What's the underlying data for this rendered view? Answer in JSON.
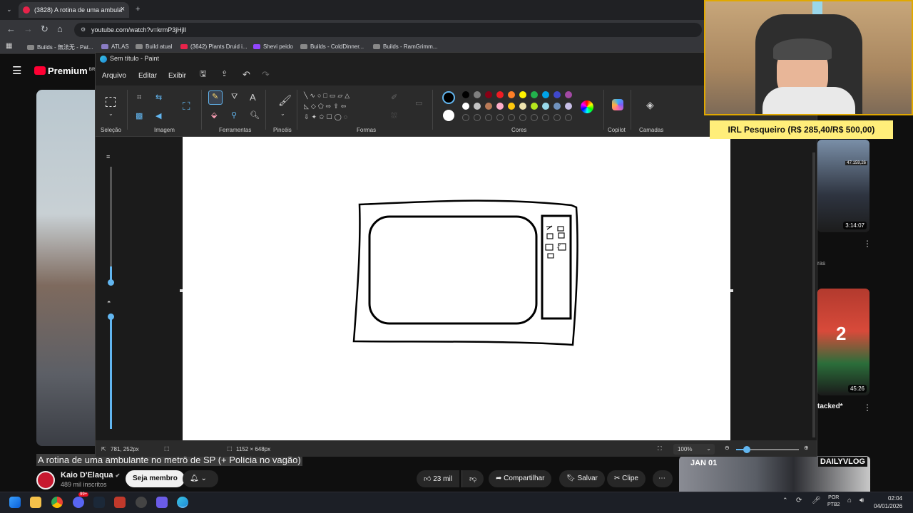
{
  "browser": {
    "tab_title": "(3828) A rotina de uma ambula",
    "url": "youtube.com/watch?v=krmP3jHjlI",
    "bookmarks": [
      "Builds - 無法无 - Pat...",
      "ATLAS",
      "Build atual",
      "(3642) Plants Druid i...",
      "Shevi peido",
      "Builds - ColdDinner...",
      "Builds - RamGrimm..."
    ]
  },
  "youtube": {
    "logo_text": "Premium",
    "logo_region": "BR",
    "video_title": "A rotina de uma ambulante no metrô de SP (+ Polícia no vagão)",
    "channel": "Kaio D'Elaqua",
    "subscribers": "489 mil inscritos",
    "join_label": "Seja membro",
    "likes": "23 mil",
    "share_label": "Compartilhar",
    "save_label": "Salvar",
    "clip_label": "Clipe",
    "thumb1_duration": "3:14:07",
    "thumb1_views": "47.159,26",
    "thumb2_duration": "45:26",
    "thumb2_fragment": "tacked*",
    "sidebar_fragment": "ras",
    "bottom_thumb_date": "JAN 01",
    "bottom_thumb_label": "DAILYVLOG"
  },
  "paint": {
    "window_title": "Sem título - Paint",
    "menu": [
      "Arquivo",
      "Editar",
      "Exibir"
    ],
    "groups": {
      "selection": "Seleção",
      "image": "Imagem",
      "tools": "Ferramentas",
      "brushes": "Pincéis",
      "shapes": "Formas",
      "colors": "Cores",
      "copilot": "Copilot",
      "layers": "Camadas"
    },
    "status": {
      "cursor": "781, 252px",
      "canvas_size": "1152 × 648px",
      "zoom": "100%"
    },
    "colors": {
      "row1": [
        "#000000",
        "#7f7f7f",
        "#880015",
        "#ed1c24",
        "#ff7f27",
        "#fff200",
        "#22b14c",
        "#00a2e8",
        "#3f48cc",
        "#a349a4"
      ],
      "row2": [
        "#ffffff",
        "#c3c3c3",
        "#b97a57",
        "#ffaec9",
        "#ffc90e",
        "#efe4b0",
        "#b5e61d",
        "#99d9ea",
        "#7092be",
        "#c8bfe7"
      ]
    },
    "drawing": {
      "description_label": "sketch"
    }
  },
  "stream": {
    "donation_goal": "IRL Pesqueiro (R$ 285,40/R$ 500,00)"
  },
  "taskbar": {
    "lang_top": "POR",
    "lang_bottom": "PTB2",
    "time": "02:04",
    "date": "04/01/2026",
    "steam_badge": "99+"
  }
}
